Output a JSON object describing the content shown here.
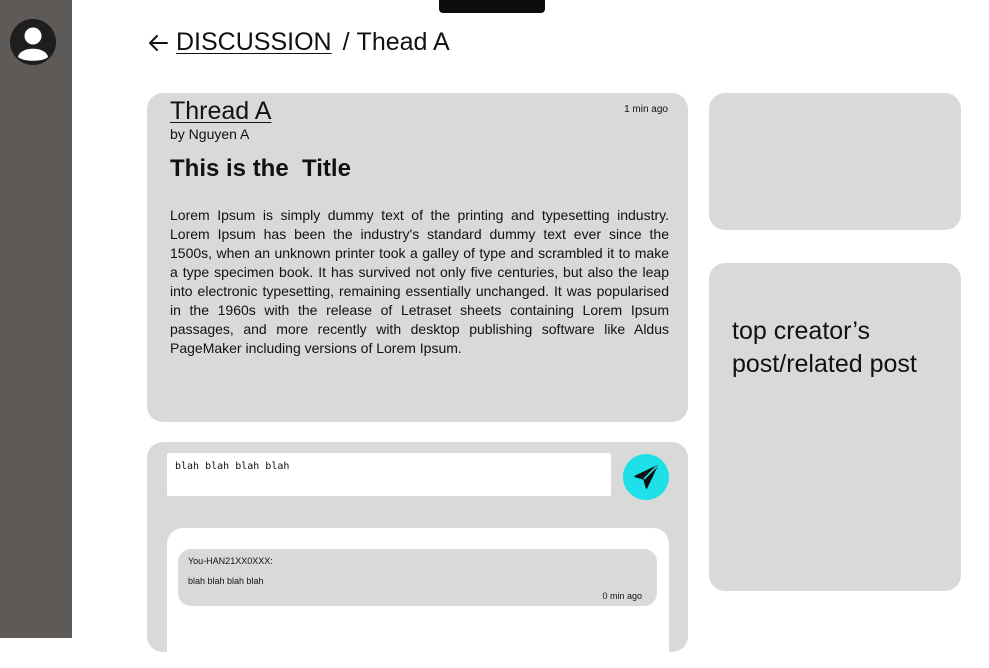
{
  "breadcrumb": {
    "parent": "DISCUSSION",
    "separator": "/",
    "current": "Thead A"
  },
  "post": {
    "thread_title": "Thread A",
    "author": "by Nguyen A",
    "timestamp": "1 min ago",
    "title": "This is the  Title",
    "body": "Lorem Ipsum is simply dummy text of the printing and typesetting industry. Lorem Ipsum has been the industry's standard dummy text ever since the 1500s, when an unknown printer took a galley of type and scrambled it to make a type specimen book. It has survived not only five centuries, but also the leap into electronic typesetting, remaining essentially unchanged. It was popularised in the 1960s with the release of Letraset sheets containing Lorem Ipsum passages, and more recently with desktop publishing software like Aldus PageMaker including versions of Lorem Ipsum."
  },
  "sidebar_panel": {
    "text": "top creator’s post/related post"
  },
  "comment_form": {
    "input_value": "blah blah blah blah",
    "send_icon": "send-icon"
  },
  "comments": [
    {
      "user": "You-HAN21XX0XXX:",
      "text": "blah blah blah blah",
      "time": "0 min ago"
    }
  ],
  "colors": {
    "sidebar": "#5e5a58",
    "card": "#d9d9d9",
    "send_button": "#1ee0e8"
  }
}
